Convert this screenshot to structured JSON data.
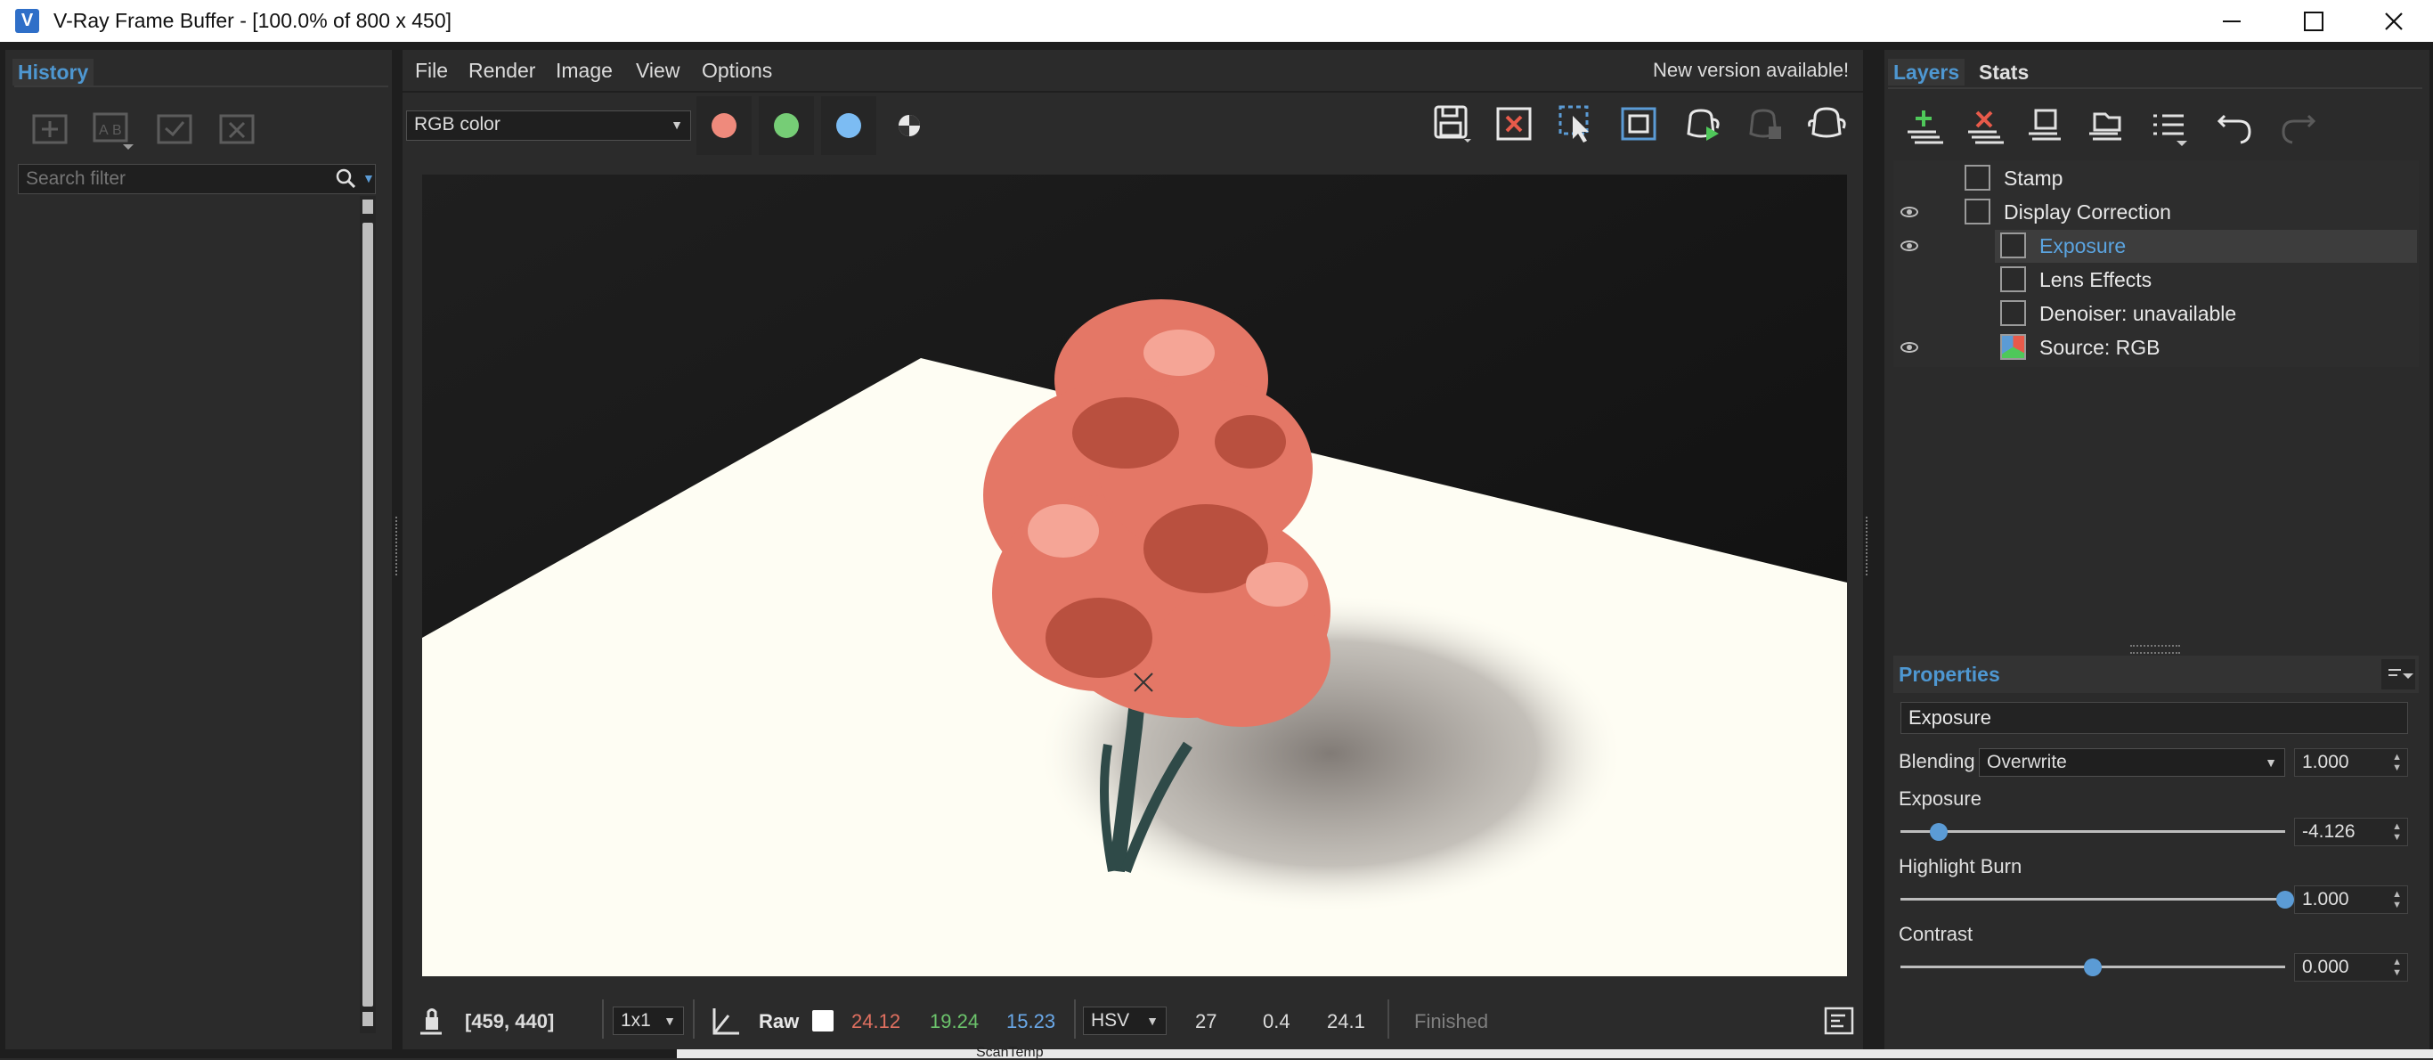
{
  "window": {
    "title": "V-Ray Frame Buffer - [100.0% of 800 x 450]",
    "logo_letter": "V"
  },
  "history": {
    "tab": "History",
    "search_placeholder": "Search filter"
  },
  "menu": {
    "file": "File",
    "render": "Render",
    "image": "Image",
    "view": "View",
    "options": "Options",
    "notice": "New version available!"
  },
  "toolbar": {
    "channel": "RGB color",
    "red_color": "#ef8a7c",
    "green_color": "#76cd76",
    "blue_color": "#7cbcf3"
  },
  "layers": {
    "tab_layers": "Layers",
    "tab_stats": "Stats",
    "items": [
      {
        "label": "Stamp",
        "visible": false,
        "icon": "stamp-icon"
      },
      {
        "label": "Display Correction",
        "visible": true,
        "icon": "curve-icon"
      },
      {
        "label": "Exposure",
        "visible": true,
        "icon": "exposure-icon",
        "selected": true
      },
      {
        "label": "Lens Effects",
        "visible": false,
        "icon": "lens-effects-icon"
      },
      {
        "label": "Denoiser: unavailable",
        "visible": false,
        "icon": "denoiser-icon"
      },
      {
        "label": "Source: RGB",
        "visible": true,
        "icon": "rgb-source-icon"
      }
    ]
  },
  "properties": {
    "header": "Properties",
    "layer_name": "Exposure",
    "blending_label": "Blending",
    "blending_mode": "Overwrite",
    "blending_amount": "1.000",
    "exposure_label": "Exposure",
    "exposure_value": "-4.126",
    "exposure_pos": 0.1,
    "highlight_label": "Highlight Burn",
    "highlight_value": "1.000",
    "highlight_pos": 1.0,
    "contrast_label": "Contrast",
    "contrast_value": "0.000",
    "contrast_pos": 0.5
  },
  "statusbar": {
    "coords": "[459, 440]",
    "sample": "1x1",
    "raw": "Raw",
    "r": "24.12",
    "g": "19.24",
    "b": "15.23",
    "colorspace": "HSV",
    "h": "27",
    "s": "0.4",
    "v": "24.1",
    "state": "Finished",
    "r_color": "#e07060",
    "g_color": "#6cc46c",
    "b_color": "#6aa8e8"
  },
  "background": {
    "taskbar_text": "ScanTemp"
  }
}
